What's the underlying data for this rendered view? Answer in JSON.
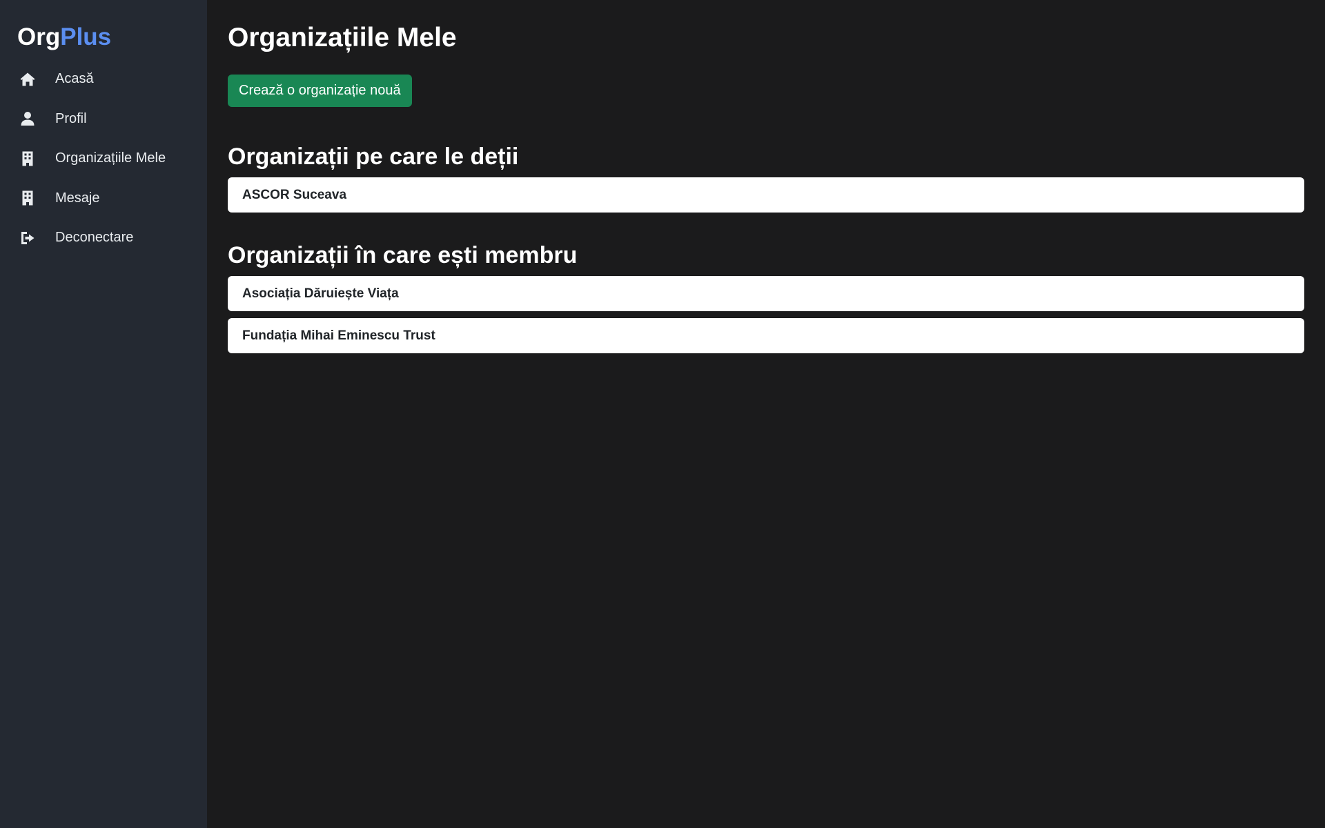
{
  "brand": {
    "part1": "Org",
    "part2": "Plus",
    "accent_color": "#5b8ef0"
  },
  "sidebar": {
    "items": [
      {
        "label": "Acasă",
        "icon": "home-icon"
      },
      {
        "label": "Profil",
        "icon": "user-icon"
      },
      {
        "label": "Organizațiile Mele",
        "icon": "building-icon"
      },
      {
        "label": "Mesaje",
        "icon": "building-icon"
      },
      {
        "label": "Deconectare",
        "icon": "logout-icon"
      }
    ]
  },
  "main": {
    "title": "Organizațiile Mele",
    "create_button": "Crează o organizație nouă",
    "owned_title": "Organizații pe care le deții",
    "owned": [
      "ASCOR Suceava"
    ],
    "member_title": "Organizații în care ești membru",
    "member": [
      "Asociația Dăruiește Viața",
      "Fundația Mihai Eminescu Trust"
    ]
  },
  "colors": {
    "sidebar_bg": "#242932",
    "main_bg": "#1b1b1c",
    "button_bg": "#198754"
  }
}
